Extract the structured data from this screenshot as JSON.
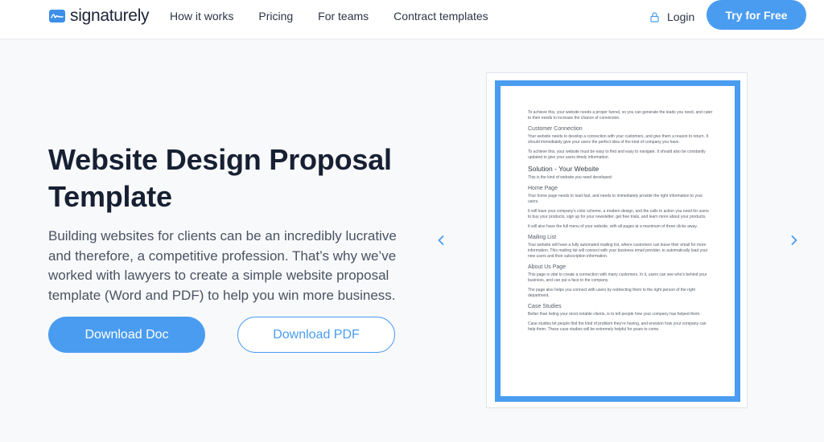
{
  "header": {
    "logo_text": "signaturely",
    "nav": [
      "How it works",
      "Pricing",
      "For teams",
      "Contract templates"
    ],
    "login_label": "Login",
    "cta_label": "Try for Free"
  },
  "hero": {
    "title": "Website Design Proposal Template",
    "description": "Building websites for clients can be an incredibly lucrative and therefore, a competitive profession. That’s why we’ve worked with lawyers to create a simple website proposal template (Word and PDF) to help you win more business.",
    "download_doc_label": "Download Doc",
    "download_pdf_label": "Download PDF"
  },
  "preview": {
    "blocks": [
      {
        "type": "p",
        "text": "To achieve this, your website needs a proper funnel, so you can generate the leads you need, and cater to their needs to increase the chance of conversion."
      },
      {
        "type": "h",
        "text": "Customer Connection"
      },
      {
        "type": "p",
        "text": "Your website needs to develop a connection with your customers, and give them a reason to return. It should immediately give your users the perfect idea of the kind of company you have."
      },
      {
        "type": "p",
        "text": "To achieve this, your website must be easy to find and easy to navigate. It should also be constantly updated to give your users timely information."
      },
      {
        "type": "h2",
        "text": "Solution - Your Website"
      },
      {
        "type": "p",
        "text": "This is the kind of website you need developed:"
      },
      {
        "type": "h",
        "text": "Home Page"
      },
      {
        "type": "p",
        "text": "Your home page needs to load fast, and needs to immediately provide the right information to your users."
      },
      {
        "type": "p",
        "text": "It will have your company’s color scheme, a modern design, and the calls to action you need for users to buy your products, sign up for your newsletter, get free trials, and learn more about your products."
      },
      {
        "type": "p",
        "text": "It will also have the full menu of your website, with all pages at a maximum of three clicks away."
      },
      {
        "type": "h",
        "text": "Mailing List"
      },
      {
        "type": "p",
        "text": "Your website will have a fully automated mailing list, where customers can leave their email for more information. This mailing list will connect with your business email provider, to automatically load your new users and their subscription information."
      },
      {
        "type": "h",
        "text": "About Us Page"
      },
      {
        "type": "p",
        "text": "This page is vital to create a connection with many customers. In it, users can see who’s behind your business, and can put a face to the company."
      },
      {
        "type": "p",
        "text": "The page also helps you connect with users by redirecting them to the right person of the right department."
      },
      {
        "type": "h",
        "text": "Case Studies"
      },
      {
        "type": "p",
        "text": "Better than listing your most notable clients, is to tell people how your company has helped them."
      },
      {
        "type": "p",
        "text": "Case studies let people find the kind of problem they’re having, and envision how your company can help them. These case studies will be extremely helpful for years to come."
      }
    ]
  },
  "icons": {
    "logo": "signature-logo-icon",
    "login": "lock-icon",
    "prev": "chevron-left-icon",
    "next": "chevron-right-icon"
  },
  "colors": {
    "accent": "#4a9cf0",
    "heading": "#172033",
    "body_text": "#4a5263",
    "page_bg": "#f8f9fa"
  }
}
